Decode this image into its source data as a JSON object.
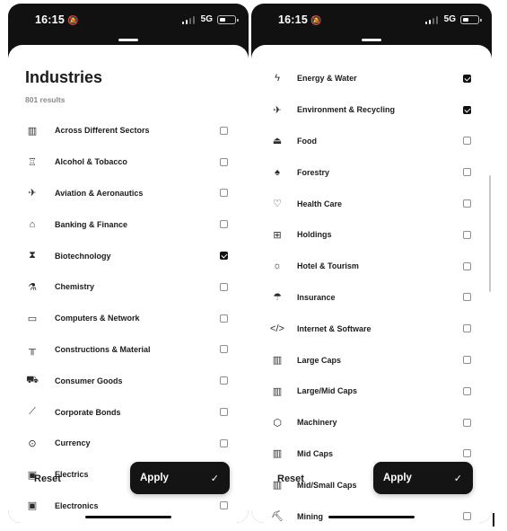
{
  "status_bar": {
    "time": "16:15",
    "network": "5G"
  },
  "left_screen": {
    "title": "Industries",
    "results": "801 results",
    "items": [
      {
        "label": "Across Different Sectors",
        "icon": "building-icon",
        "glyph": "▥",
        "checked": false
      },
      {
        "label": "Alcohol & Tobacco",
        "icon": "glass-icon",
        "glyph": "♖",
        "checked": false
      },
      {
        "label": "Aviation & Aeronautics",
        "icon": "plane-icon",
        "glyph": "✈",
        "checked": false
      },
      {
        "label": "Banking & Finance",
        "icon": "bank-icon",
        "glyph": "⌂",
        "checked": false
      },
      {
        "label": "Biotechnology",
        "icon": "hourglass-icon",
        "glyph": "⧗",
        "checked": true
      },
      {
        "label": "Chemistry",
        "icon": "flask-icon",
        "glyph": "⚗",
        "checked": false
      },
      {
        "label": "Computers & Network",
        "icon": "laptop-icon",
        "glyph": "▭",
        "checked": false
      },
      {
        "label": "Constructions & Material",
        "icon": "barrier-icon",
        "glyph": "╥",
        "checked": false
      },
      {
        "label": "Consumer Goods",
        "icon": "cart-icon",
        "glyph": "⛟",
        "checked": false
      },
      {
        "label": "Corporate Bonds",
        "icon": "chart-icon",
        "glyph": "⟋",
        "checked": false
      },
      {
        "label": "Currency",
        "icon": "coin-icon",
        "glyph": "⊙",
        "checked": false
      },
      {
        "label": "Electrics",
        "icon": "chip-icon",
        "glyph": "▣",
        "checked": false
      },
      {
        "label": "Electronics",
        "icon": "circuit-icon",
        "glyph": "▣",
        "checked": false
      }
    ],
    "reset_label": "Reset",
    "apply_label": "Apply"
  },
  "right_screen": {
    "items": [
      {
        "label": "Energy & Water",
        "icon": "bolt-icon",
        "glyph": "ϟ",
        "checked": true
      },
      {
        "label": "Environment & Recycling",
        "icon": "airplane-icon",
        "glyph": "✈",
        "checked": true
      },
      {
        "label": "Food",
        "icon": "dish-icon",
        "glyph": "⏏",
        "checked": false
      },
      {
        "label": "Forestry",
        "icon": "tree-icon",
        "glyph": "♠",
        "checked": false
      },
      {
        "label": "Health Care",
        "icon": "heart-icon",
        "glyph": "♡",
        "checked": false
      },
      {
        "label": "Holdings",
        "icon": "nodes-icon",
        "glyph": "⊞",
        "checked": false
      },
      {
        "label": "Hotel & Tourism",
        "icon": "sun-icon",
        "glyph": "☼",
        "checked": false
      },
      {
        "label": "Insurance",
        "icon": "umbrella-icon",
        "glyph": "☂",
        "checked": false
      },
      {
        "label": "Internet & Software",
        "icon": "code-icon",
        "glyph": "</>",
        "checked": false
      },
      {
        "label": "Large Caps",
        "icon": "office-icon",
        "glyph": "▥",
        "checked": false
      },
      {
        "label": "Large/Mid Caps",
        "icon": "office-icon",
        "glyph": "▥",
        "checked": false
      },
      {
        "label": "Machinery",
        "icon": "gear-icon",
        "glyph": "⬡",
        "checked": false
      },
      {
        "label": "Mid Caps",
        "icon": "office-icon",
        "glyph": "▥",
        "checked": false
      },
      {
        "label": "Mid/Small Caps",
        "icon": "office-icon",
        "glyph": "▥",
        "checked": false
      },
      {
        "label": "Mining",
        "icon": "pickaxe-icon",
        "glyph": "⛏",
        "checked": false
      }
    ],
    "reset_label": "Reset",
    "apply_label": "Apply"
  },
  "colors": {
    "accent": "#141414",
    "muted": "#8a8a8e"
  }
}
